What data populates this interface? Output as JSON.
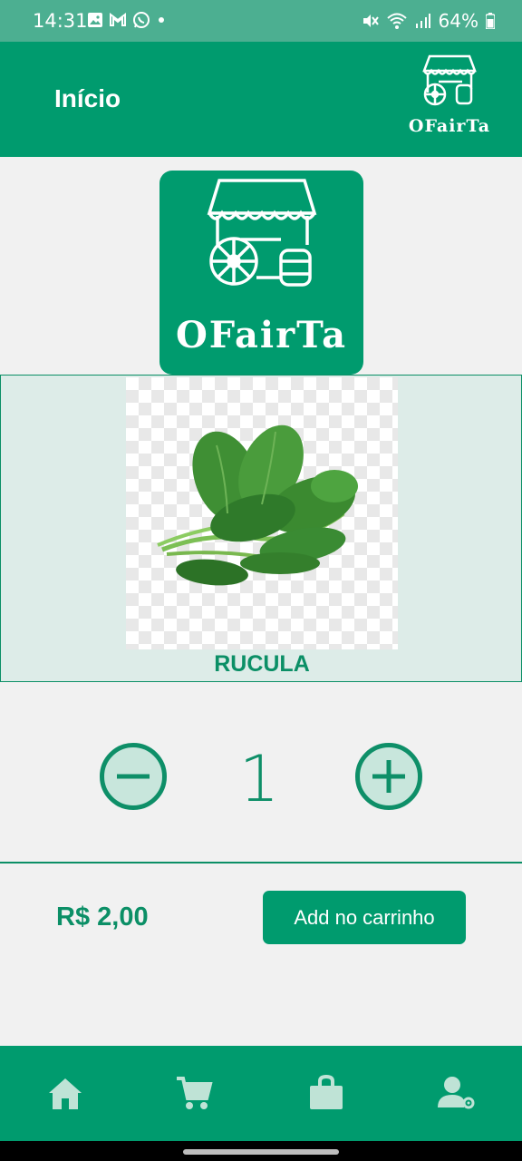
{
  "status_bar": {
    "time": "14:31",
    "battery": "64%"
  },
  "app_bar": {
    "title": "Início",
    "logo_text": "OFairTa"
  },
  "hero": {
    "logo_text": "OFairTa"
  },
  "product": {
    "name": "RUCULA",
    "image_alt": "rucula-leaves"
  },
  "quantity": {
    "value": "1"
  },
  "footer": {
    "price": "R$ 2,00",
    "add_button": "Add no carrinho"
  },
  "nav": [
    {
      "icon": "home-icon"
    },
    {
      "icon": "cart-icon"
    },
    {
      "icon": "bag-icon"
    },
    {
      "icon": "user-settings-icon"
    }
  ],
  "colors": {
    "primary": "#009b6e",
    "accent": "#0b8f66",
    "card_bg": "#ddece8",
    "status_bar": "#4caf91"
  }
}
